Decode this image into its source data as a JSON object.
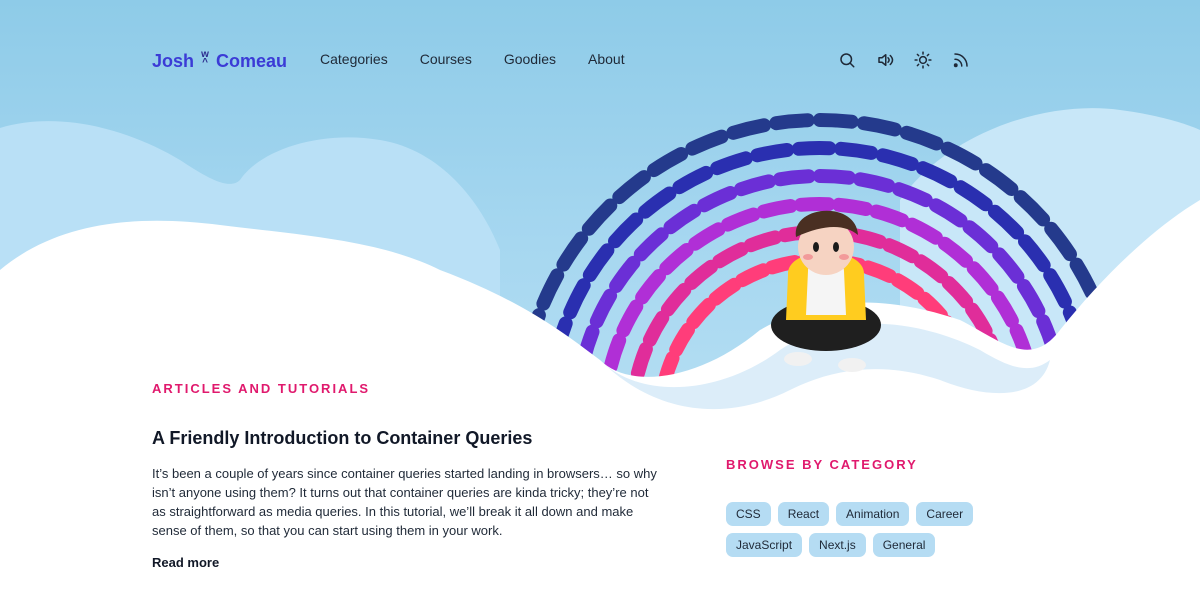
{
  "logo": {
    "first": "Josh",
    "last": "Comeau"
  },
  "nav": [
    "Categories",
    "Courses",
    "Goodies",
    "About"
  ],
  "icons": [
    "search-icon",
    "sound-icon",
    "sun-icon",
    "rss-icon"
  ],
  "articles": {
    "section_label": "Articles and Tutorials",
    "title": "A Friendly Introduction to Container Queries",
    "excerpt": "It’s been a couple of years since container queries started landing in browsers… so why isn’t anyone using them? It turns out that container queries are kinda tricky; they’re not as straightforward as media queries. In this tutorial, we’ll break it all down and make sense of them, so that you can start using them in your work.",
    "read_more": "Read more"
  },
  "categories": {
    "label": "Browse by Category",
    "items": [
      "CSS",
      "React",
      "Animation",
      "Career",
      "JavaScript",
      "Next.js",
      "General"
    ]
  },
  "colors": {
    "accent": "#e0196d",
    "logo": "#3b3bd6",
    "chip_bg": "#b5dcf3",
    "rainbow": [
      "#243a8c",
      "#2a2fb0",
      "#6b2fd6",
      "#b02fd6",
      "#e02d9a",
      "#ff3d7a"
    ]
  }
}
